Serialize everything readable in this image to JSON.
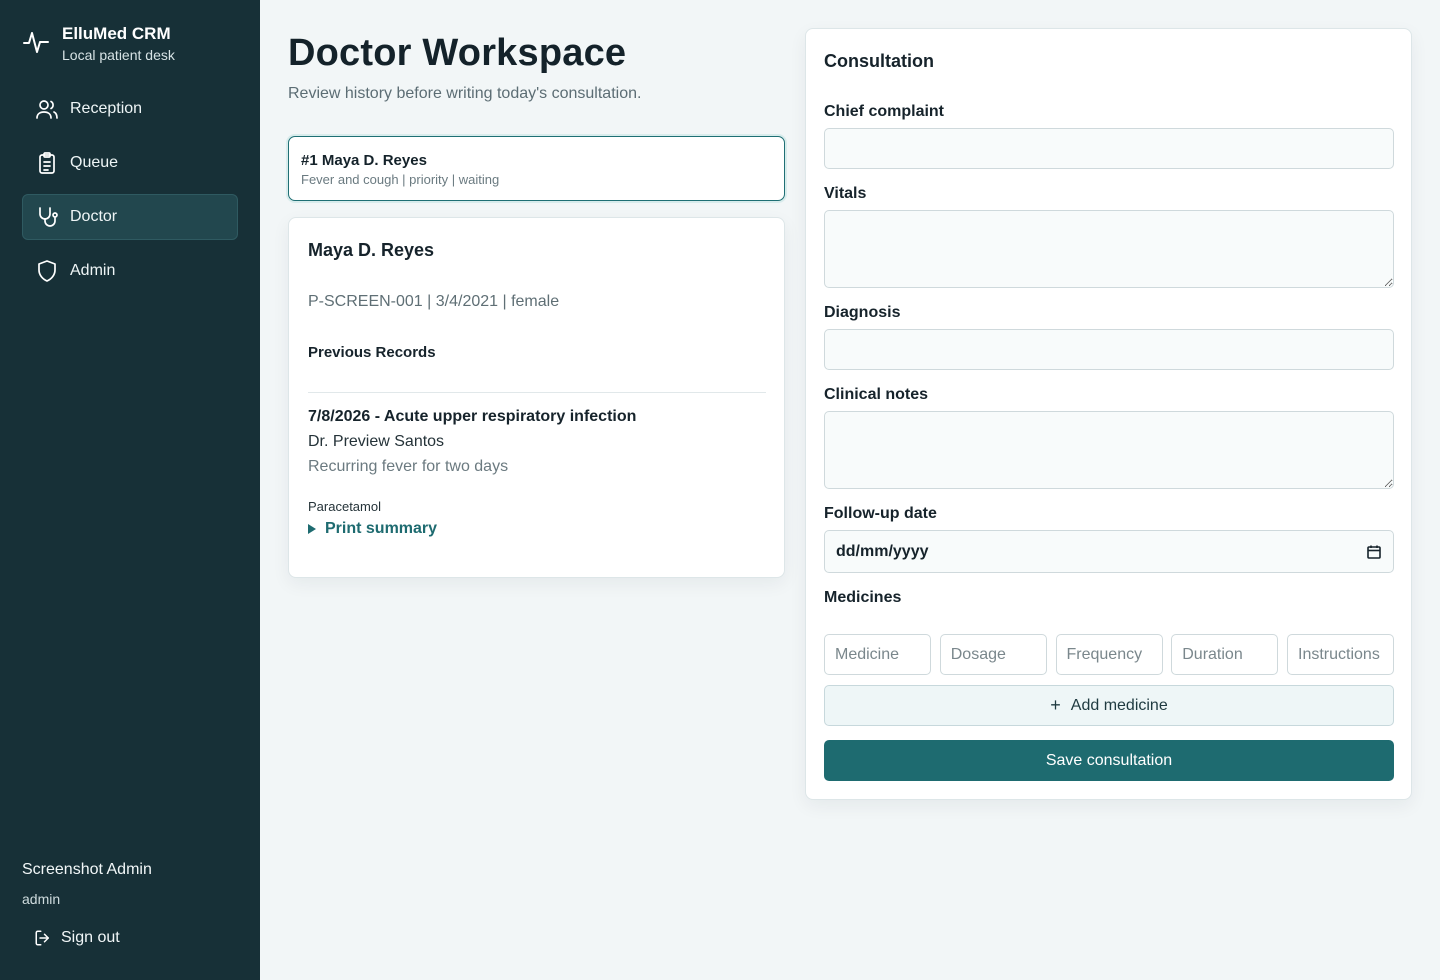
{
  "brand": {
    "title": "ElluMed CRM",
    "subtitle": "Local patient desk",
    "icon": "activity-pulse-icon"
  },
  "sidebar": {
    "items": [
      {
        "label": "Reception",
        "icon": "users-icon",
        "active": false
      },
      {
        "label": "Queue",
        "icon": "clipboard-list-icon",
        "active": false
      },
      {
        "label": "Doctor",
        "icon": "stethoscope-icon",
        "active": true
      },
      {
        "label": "Admin",
        "icon": "shield-icon",
        "active": false
      }
    ],
    "user_name": "Screenshot Admin",
    "user_role": "admin",
    "signout_label": "Sign out"
  },
  "page": {
    "title": "Doctor Workspace",
    "subtitle": "Review history before writing today's consultation."
  },
  "queue_entry": {
    "title": "#1 Maya D. Reyes",
    "meta": "Fever and cough | priority | waiting"
  },
  "patient": {
    "name": "Maya D. Reyes",
    "meta": "P-SCREEN-001 | 3/4/2021 | female",
    "previous_records_label": "Previous Records",
    "records": [
      {
        "title": "7/8/2026 - Acute upper respiratory infection",
        "doctor": "Dr. Preview Santos",
        "note": "Recurring fever for two days",
        "medicines": "Paracetamol",
        "print_label": "Print summary"
      }
    ]
  },
  "consultation": {
    "title": "Consultation",
    "chief_complaint_label": "Chief complaint",
    "chief_complaint_value": "",
    "vitals_label": "Vitals",
    "vitals_value": "",
    "diagnosis_label": "Diagnosis",
    "diagnosis_value": "",
    "notes_label": "Clinical notes",
    "notes_value": "",
    "followup_label": "Follow-up date",
    "followup_placeholder": "dd/mm/yyyy",
    "medicines_label": "Medicines",
    "medicine_placeholders": {
      "medicine": "Medicine",
      "dosage": "Dosage",
      "frequency": "Frequency",
      "duration": "Duration",
      "instructions": "Instructions"
    },
    "add_medicine_label": "Add medicine",
    "save_label": "Save consultation"
  },
  "colors": {
    "sidebar_bg": "#173037",
    "accent": "#1e6b70",
    "page_bg": "#f2f6f7"
  }
}
